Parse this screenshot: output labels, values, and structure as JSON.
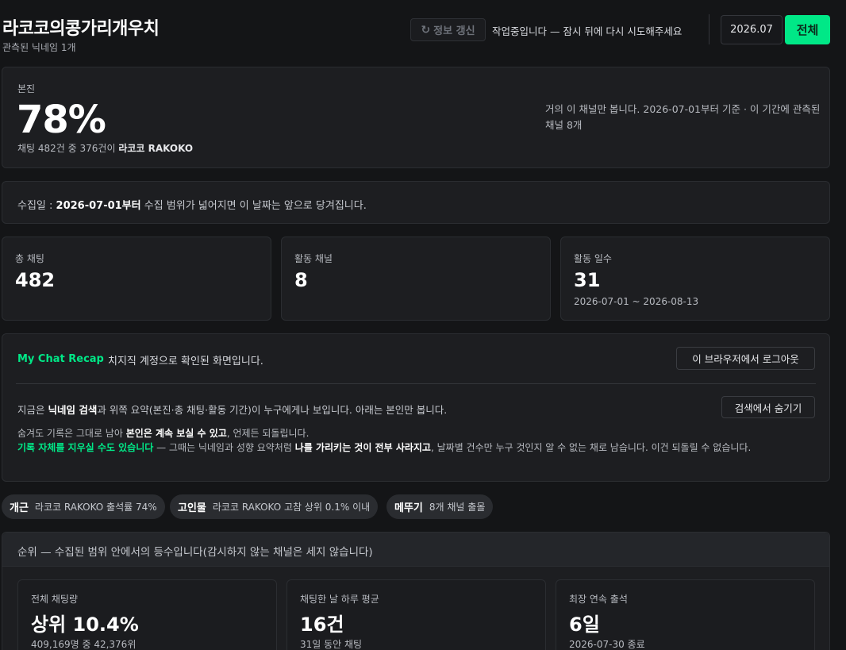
{
  "header": {
    "title": "라코코의콩가리개우치",
    "subtitle": "관측된 닉네임 1개",
    "refresh_label": "정보 갱신",
    "status": "작업중입니다 — 잠시 뒤에 다시 시도해주세요",
    "month": "2026.07",
    "all_label": "전체"
  },
  "self": {
    "label": "본진",
    "percent": "78%",
    "detail_prefix": "채팅 482건 중 376건이 ",
    "channel": "라코코 RAKOKO",
    "note": "거의 이 채널만 봅니다. 2026-07-01부터 기준 · 이 기간에 관측된 채널 8개"
  },
  "collect": {
    "prefix": "수집일 : ",
    "date": "2026-07-01부터",
    "suffix": " 수집 범위가 넓어지면 이 날짜는 앞으로 당겨집니다."
  },
  "stats": [
    {
      "label": "총 채팅",
      "value": "482",
      "sub": ""
    },
    {
      "label": "활동 채널",
      "value": "8",
      "sub": ""
    },
    {
      "label": "활동 일수",
      "value": "31",
      "sub": "2026-07-01 ~ 2026-08-13"
    }
  ],
  "recap": {
    "brand": "My Chat Recap",
    "desc": "치지직 계정으로 확인된 화면입니다.",
    "logout_label": "이 브라우저에서 로그아웃",
    "hide_label": "검색에서 숨기기",
    "line1_a": "지금은 ",
    "line1_b": "닉네임 검색",
    "line1_c": "과 위쪽 요약(본진·총 채팅·활동 기간)이 누구에게나 보입니다. 아래는 본인만 봅니다.",
    "line2_a": "숨겨도 기록은 그대로 남아 ",
    "line2_b": "본인은 계속 보실 수 있고",
    "line2_c": ", 언제든 되돌립니다.",
    "line3_green": "기록 자체를 지우실 수도 있습니다",
    "line3_a": " — 그때는 닉네임과 성향 요약처럼 ",
    "line3_b": "나를 가리키는 것이 전부 사라지고",
    "line3_c": ", 날짜별 건수만 누구 것인지 알 수 없는 채로 남습니다. 이건 되돌릴 수 없습니다."
  },
  "badges": [
    {
      "title": "개근",
      "desc": "라코코 RAKOKO 출석률 74%"
    },
    {
      "title": "고인물",
      "desc": "라코코 RAKOKO 고참 상위 0.1% 이내"
    },
    {
      "title": "메뚜기",
      "desc": "8개 채널 출몰"
    }
  ],
  "rank": {
    "heading": "순위 — 수집된 범위 안에서의 등수입니다(감시하지 않는 채널은 세지 않습니다)",
    "items": [
      {
        "label": "전체 채팅량",
        "value": "상위 10.4%",
        "sub": "409,169명 중 42,376위"
      },
      {
        "label": "채팅한 날 하루 평균",
        "value": "16건",
        "sub": "31일 동안 채팅"
      },
      {
        "label": "최장 연속 출석",
        "value": "6일",
        "sub": "2026-07-30 종료"
      }
    ]
  }
}
